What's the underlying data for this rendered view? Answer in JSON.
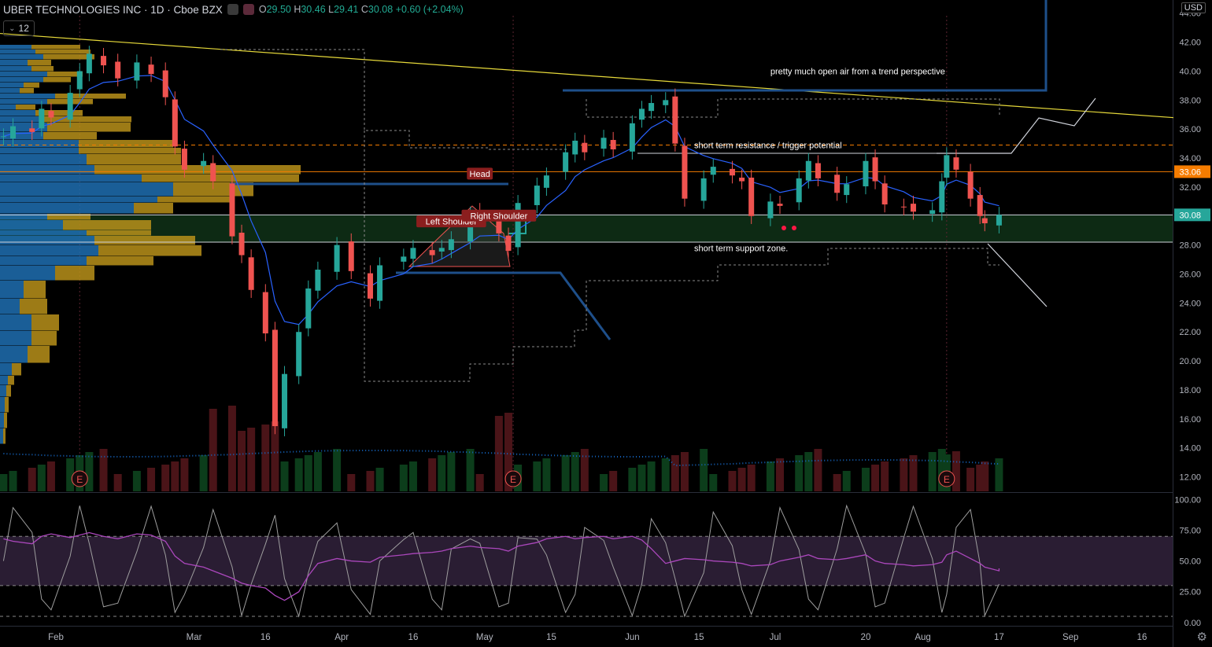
{
  "header": {
    "symbol": "UBER TECHNOLOGIES INC · 1D · Cboe BZX",
    "open_label": "O",
    "open": "29.50",
    "high_label": "H",
    "high": "30.46",
    "low_label": "L",
    "low": "29.41",
    "close_label": "C",
    "close": "30.08",
    "change": "+0.60 (+2.04%)",
    "ma_period": "12",
    "currency": "USD"
  },
  "colors": {
    "background": "#000000",
    "up": "#26a69a",
    "down": "#ef5350",
    "ma": "#2962ff",
    "trendline_yellow": "#e6d93a",
    "resistance_orange": "#f57c00",
    "zone_green": "#0d2a14",
    "rsi_line": "#ab47bc",
    "rsi_band": "#2a1d33"
  },
  "chart_data": [
    {
      "type": "candlestick",
      "panel": "price",
      "ylim": [
        11,
        44.8
      ],
      "y_ticks": [
        12,
        14,
        16,
        18,
        20,
        22,
        24,
        26,
        28,
        30,
        32,
        34,
        36,
        38,
        40,
        42,
        44
      ],
      "x_ticks": [
        "Feb",
        "Mar",
        "16",
        "Apr",
        "16",
        "May",
        "15",
        "Jun",
        "15",
        "Jul",
        "20",
        "Aug",
        "17",
        "Sep",
        "16"
      ],
      "x_tick_dates": [
        "2020-02-01",
        "2020-03-01",
        "2020-03-16",
        "2020-04-01",
        "2020-04-16",
        "2020-05-01",
        "2020-05-15",
        "2020-06-01",
        "2020-06-15",
        "2020-07-01",
        "2020-07-20",
        "2020-08-01",
        "2020-08-17",
        "2020-09-01",
        "2020-09-16"
      ],
      "price_labels": [
        {
          "value": 33.06,
          "color": "#f57c00",
          "text": "33.06"
        },
        {
          "value": 30.08,
          "color": "#26a69a",
          "text": "30.08"
        }
      ],
      "closes": [
        {
          "date": "2020-01-21",
          "close": 35.5
        },
        {
          "date": "2020-01-23",
          "close": 36.2
        },
        {
          "date": "2020-01-27",
          "close": 35.8
        },
        {
          "date": "2020-01-29",
          "close": 37.4
        },
        {
          "date": "2020-01-31",
          "close": 36.8
        },
        {
          "date": "2020-02-04",
          "close": 38.5
        },
        {
          "date": "2020-02-06",
          "close": 40.0
        },
        {
          "date": "2020-02-08",
          "close": 41.2
        },
        {
          "date": "2020-02-11",
          "close": 40.4
        },
        {
          "date": "2020-02-14",
          "close": 39.5
        },
        {
          "date": "2020-02-18",
          "close": 40.6
        },
        {
          "date": "2020-02-21",
          "close": 39.8
        },
        {
          "date": "2020-02-24",
          "close": 38.2
        },
        {
          "date": "2020-02-26",
          "close": 34.8
        },
        {
          "date": "2020-02-28",
          "close": 33.2
        },
        {
          "date": "2020-03-03",
          "close": 33.8
        },
        {
          "date": "2020-03-05",
          "close": 32.4
        },
        {
          "date": "2020-03-09",
          "close": 28.6
        },
        {
          "date": "2020-03-11",
          "close": 27.3
        },
        {
          "date": "2020-03-13",
          "close": 24.9
        },
        {
          "date": "2020-03-16",
          "close": 21.9
        },
        {
          "date": "2020-03-18",
          "close": 15.5
        },
        {
          "date": "2020-03-20",
          "close": 19.1
        },
        {
          "date": "2020-03-23",
          "close": 22.0
        },
        {
          "date": "2020-03-25",
          "close": 25.0
        },
        {
          "date": "2020-03-27",
          "close": 26.3
        },
        {
          "date": "2020-03-31",
          "close": 28.0
        },
        {
          "date": "2020-04-03",
          "close": 26.2
        },
        {
          "date": "2020-04-07",
          "close": 24.3
        },
        {
          "date": "2020-04-09",
          "close": 26.6
        },
        {
          "date": "2020-04-14",
          "close": 27.2
        },
        {
          "date": "2020-04-16",
          "close": 27.8
        },
        {
          "date": "2020-04-20",
          "close": 27.3
        },
        {
          "date": "2020-04-22",
          "close": 27.8
        },
        {
          "date": "2020-04-24",
          "close": 28.4
        },
        {
          "date": "2020-04-28",
          "close": 30.1
        },
        {
          "date": "2020-04-30",
          "close": 29.8
        },
        {
          "date": "2020-05-04",
          "close": 28.8
        },
        {
          "date": "2020-05-06",
          "close": 27.6
        },
        {
          "date": "2020-05-08",
          "close": 30.9
        },
        {
          "date": "2020-05-12",
          "close": 32.1
        },
        {
          "date": "2020-05-14",
          "close": 32.8
        },
        {
          "date": "2020-05-18",
          "close": 34.4
        },
        {
          "date": "2020-05-20",
          "close": 35.2
        },
        {
          "date": "2020-05-22",
          "close": 34.4
        },
        {
          "date": "2020-05-26",
          "close": 35.4
        },
        {
          "date": "2020-05-28",
          "close": 34.6
        },
        {
          "date": "2020-06-01",
          "close": 36.4
        },
        {
          "date": "2020-06-03",
          "close": 37.4
        },
        {
          "date": "2020-06-05",
          "close": 37.8
        },
        {
          "date": "2020-06-08",
          "close": 38.0
        },
        {
          "date": "2020-06-10",
          "close": 35.0
        },
        {
          "date": "2020-06-12",
          "close": 31.2
        },
        {
          "date": "2020-06-16",
          "close": 32.6
        },
        {
          "date": "2020-06-18",
          "close": 33.4
        },
        {
          "date": "2020-06-22",
          "close": 32.8
        },
        {
          "date": "2020-06-24",
          "close": 32.4
        },
        {
          "date": "2020-06-26",
          "close": 30.0
        },
        {
          "date": "2020-06-30",
          "close": 31.0
        },
        {
          "date": "2020-07-02",
          "close": 30.7
        },
        {
          "date": "2020-07-06",
          "close": 32.6
        },
        {
          "date": "2020-07-08",
          "close": 33.8
        },
        {
          "date": "2020-07-10",
          "close": 32.6
        },
        {
          "date": "2020-07-14",
          "close": 31.6
        },
        {
          "date": "2020-07-16",
          "close": 32.2
        },
        {
          "date": "2020-07-20",
          "close": 33.8
        },
        {
          "date": "2020-07-22",
          "close": 32.4
        },
        {
          "date": "2020-07-24",
          "close": 30.8
        },
        {
          "date": "2020-07-28",
          "close": 30.6
        },
        {
          "date": "2020-07-30",
          "close": 30.3
        },
        {
          "date": "2020-08-03",
          "close": 30.4
        },
        {
          "date": "2020-08-05",
          "close": 32.4
        },
        {
          "date": "2020-08-06",
          "close": 34.2
        },
        {
          "date": "2020-08-08",
          "close": 33.2
        },
        {
          "date": "2020-08-11",
          "close": 31.2
        },
        {
          "date": "2020-08-13",
          "close": 30.0
        },
        {
          "date": "2020-08-14",
          "close": 29.5
        },
        {
          "date": "2020-08-17",
          "close": 30.08
        }
      ],
      "earnings_markers": [
        {
          "date": "2020-02-06",
          "label": "E"
        },
        {
          "date": "2020-05-07",
          "label": "E"
        },
        {
          "date": "2020-08-06",
          "label": "E"
        }
      ],
      "pattern_labels": [
        {
          "text": "Head",
          "date": "2020-04-30",
          "price": 32.9
        },
        {
          "text": "Left Shoulder",
          "date": "2020-04-24",
          "price": 29.6
        },
        {
          "text": "Right Shoulder",
          "date": "2020-05-04",
          "price": 30.0
        }
      ],
      "annotations": [
        {
          "text": "pretty much open air from a trend perspective",
          "date": "2020-06-30",
          "price": 40.0
        },
        {
          "text": "short term resistance / trigger potential",
          "date": "2020-06-14",
          "price": 34.9
        },
        {
          "text": "short term support zone.",
          "date": "2020-06-14",
          "price": 27.8
        }
      ],
      "levels": [
        {
          "price": 34.9,
          "style": "dashed",
          "color": "#f57c00"
        },
        {
          "price": 33.06,
          "style": "solid",
          "color": "#f57c00"
        },
        {
          "price": 30.08,
          "style": "solid",
          "color": "#d1d4dc"
        },
        {
          "price": 28.2,
          "style": "solid",
          "color": "#d1d4dc"
        }
      ],
      "support_zone": [
        28.2,
        30.08
      ],
      "trendline": {
        "from": {
          "date": "2020-01-14",
          "price": 42.6
        },
        "to": {
          "date": "2020-10-01",
          "price": 36.6
        }
      },
      "grid": false,
      "legend": "none"
    },
    {
      "type": "volume",
      "panel": "price",
      "note": "volume histogram overlay at bottom of price pane"
    },
    {
      "type": "line",
      "panel": "rsi",
      "ylim": [
        -2,
        104
      ],
      "y_ticks": [
        0,
        25,
        50,
        75,
        100
      ],
      "y_tick_labels": [
        "0.00",
        "25.00",
        "50.00",
        "75.00",
        "100.00"
      ],
      "bands": [
        30,
        70
      ],
      "extremes": [
        5,
        100
      ],
      "series": [
        {
          "values": [
            68,
            66,
            64,
            70,
            72,
            69,
            71,
            73,
            70,
            68,
            72,
            71,
            66,
            54,
            48,
            45,
            42,
            36,
            32,
            30,
            28,
            22,
            18,
            25,
            38,
            48,
            52,
            50,
            49,
            53,
            55,
            56,
            57,
            58,
            60,
            62,
            61,
            60,
            58,
            62,
            65,
            68,
            70,
            68,
            69,
            70,
            68,
            70,
            67,
            60,
            48,
            50,
            52,
            51,
            50,
            49,
            48,
            46,
            47,
            50,
            53,
            55,
            52,
            51,
            52,
            55,
            50,
            48,
            47,
            46,
            47,
            49,
            55,
            58,
            52,
            48,
            45,
            42,
            44
          ]
        }
      ]
    }
  ]
}
